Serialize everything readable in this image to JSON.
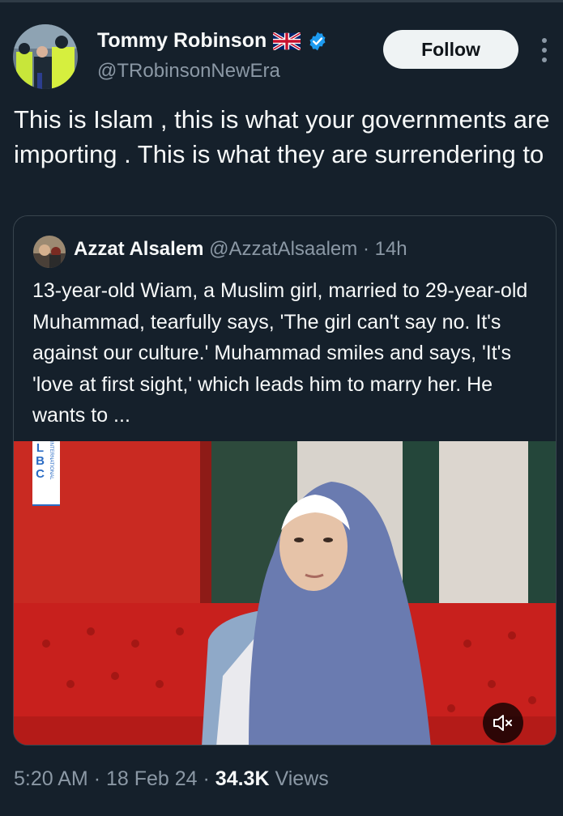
{
  "author": {
    "name": "Tommy Robinson",
    "handle": "@TRobinsonNewEra",
    "flag_icon": "uk-flag-icon",
    "verified_icon": "verified-badge-icon"
  },
  "follow_label": "Follow",
  "tweet_text": "This is Islam , this is what your governments are importing . This is what they are surrendering to",
  "quote": {
    "name": "Azzat Alsalem",
    "handle": "@AzzatAlsaalem",
    "separator": "·",
    "time": "14h",
    "text": "13-year-old Wiam, a Muslim girl, married to 29-year-old Muhammad, tearfully says, 'The girl can't say no. It's against our culture.' Muhammad smiles and says, 'It's 'love at first sight,' which leads him to marry her. He wants to ...",
    "media_logo": "LBC",
    "media_logo_sub": "INTERNATIONAL"
  },
  "footer": {
    "time": "5:20 AM",
    "sep1": "·",
    "date": "18 Feb 24",
    "sep2": "·",
    "views_count": "34.3K",
    "views_label": "Views"
  },
  "colors": {
    "background": "#15202b",
    "text": "#f7f9f9",
    "muted": "#8b98a5",
    "verified": "#1d9bf0",
    "border": "#38444d"
  }
}
